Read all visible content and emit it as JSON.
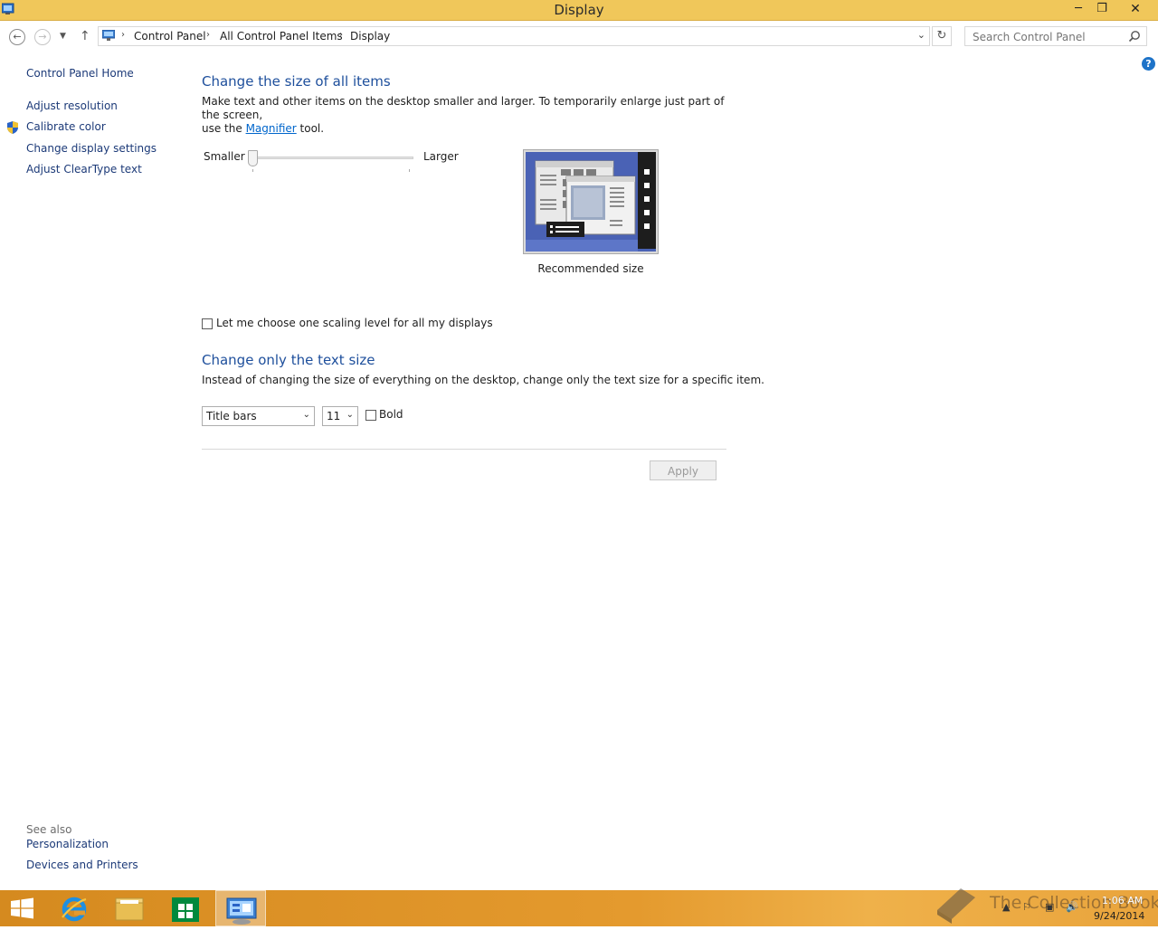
{
  "window": {
    "title": "Display",
    "minimize_glyph": "─",
    "maximize_glyph": "❐",
    "close_glyph": "✕"
  },
  "nav": {
    "back_glyph": "←",
    "forward_glyph": "→",
    "recent_glyph": "▼",
    "up_glyph": "↑",
    "breadcrumbs": [
      "Control Panel",
      "All Control Panel Items",
      "Display"
    ],
    "separator_glyph": "›",
    "dropdown_glyph": "⌄",
    "refresh_glyph": "↻",
    "search_placeholder": "Search Control Panel",
    "help_glyph": "?"
  },
  "sidebar": {
    "home": "Control Panel Home",
    "links": [
      "Adjust resolution",
      "Calibrate color",
      "Change display settings",
      "Adjust ClearType text"
    ],
    "see_also_title": "See also",
    "see_also": [
      "Personalization",
      "Devices and Printers"
    ]
  },
  "main": {
    "size_heading": "Change the size of all items",
    "size_desc_1": "Make text and other items on the desktop smaller and larger. To temporarily enlarge just part of the screen,",
    "size_desc_2_pre": "use the",
    "magnifier_link": "Magnifier",
    "size_desc_2_post": "tool.",
    "slider": {
      "min_label": "Smaller",
      "max_label": "Larger",
      "value_fraction": 0.0
    },
    "preview_caption": "Recommended size",
    "scaling_checkbox_label": "Let me choose one scaling level for all my displays",
    "scaling_checked": false,
    "text_heading": "Change only the text size",
    "text_desc": "Instead of changing the size of everything on the desktop, change only the text size for a specific item.",
    "item_select": "Title bars",
    "size_select": "11",
    "select_caret": "⌄",
    "bold_label": "Bold",
    "bold_checked": false,
    "apply_label": "Apply"
  },
  "taskbar": {
    "watermark": "The Collection Book",
    "time": "1:06 AM",
    "date": "9/24/2014",
    "tray_glyphs": [
      "▲",
      "⚐",
      "▣",
      "🔊"
    ]
  },
  "colors": {
    "titlebar": "#f0c75a",
    "heading": "#1e4f9c",
    "link": "#1c3a78",
    "taskbar": "#e49a2e"
  }
}
